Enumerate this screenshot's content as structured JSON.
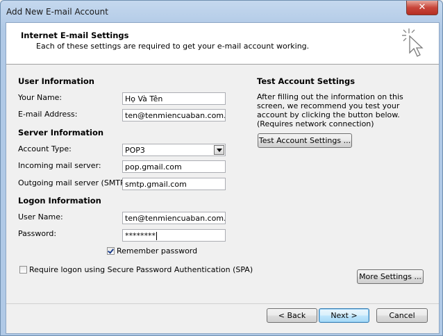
{
  "window": {
    "title": "Add New E-mail Account",
    "close_glyph": "✕"
  },
  "header": {
    "title": "Internet E-mail Settings",
    "subtitle": "Each of these settings are required to get your e-mail account working.",
    "icon": "cursor-sparkle-icon"
  },
  "user_info": {
    "heading": "User Information",
    "name_label": "Your Name:",
    "name_value": "Họ Và Tên",
    "email_label": "E-mail Address:",
    "email_value": "ten@tenmiencuaban.com.vn"
  },
  "server_info": {
    "heading": "Server Information",
    "account_type_label": "Account Type:",
    "account_type_value": "POP3",
    "incoming_label": "Incoming mail server:",
    "incoming_value": "pop.gmail.com",
    "outgoing_label": "Outgoing mail server (SMTP):",
    "outgoing_value": "smtp.gmail.com"
  },
  "logon_info": {
    "heading": "Logon Information",
    "username_label": "User Name:",
    "username_value": "ten@tenmiencuaban.com.vn",
    "password_label": "Password:",
    "password_value": "********",
    "remember_label": "Remember password",
    "remember_checked": true,
    "spa_label": "Require logon using Secure Password Authentication (SPA)",
    "spa_checked": false
  },
  "test": {
    "heading": "Test Account Settings",
    "description": "After filling out the information on this screen, we recommend you test your account by clicking the button below. (Requires network connection)",
    "button": "Test Account Settings ..."
  },
  "buttons": {
    "more_settings": "More Settings ...",
    "back": "< Back",
    "next": "Next >",
    "cancel": "Cancel"
  }
}
